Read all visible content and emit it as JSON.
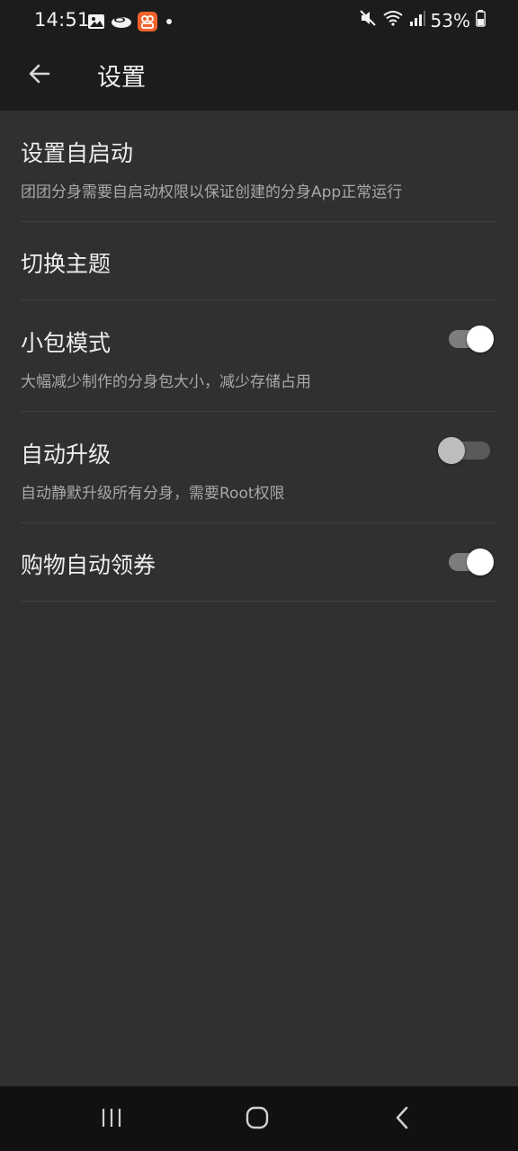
{
  "status_bar": {
    "time": "14:51",
    "battery_percent": "53%",
    "icons": [
      "image-icon",
      "cloud-app-icon",
      "app-notification-icon",
      "dot-icon",
      "mute-icon",
      "wifi-icon",
      "signal-icon",
      "battery-icon"
    ]
  },
  "app_bar": {
    "title": "设置",
    "back_icon": "arrow-left-icon"
  },
  "settings": {
    "auto_start": {
      "title": "设置自启动",
      "desc": "团团分身需要自启动权限以保证创建的分身App正常运行"
    },
    "theme": {
      "title": "切换主题"
    },
    "small_package": {
      "title": "小包模式",
      "desc": "大幅减少制作的分身包大小，减少存储占用",
      "enabled": true
    },
    "auto_upgrade": {
      "title": "自动升级",
      "desc": "自动静默升级所有分身，需要Root权限",
      "enabled": false
    },
    "coupon": {
      "title": "购物自动领券",
      "enabled": true
    }
  },
  "nav_bar": {
    "icons": [
      "recent-apps-icon",
      "home-icon",
      "back-icon"
    ]
  },
  "colors": {
    "background": "#303030",
    "app_bar": "#1c1c1c",
    "divider": "#414141",
    "toggle_on_thumb": "#ffffff",
    "toggle_off_thumb": "#bdbdbd"
  }
}
